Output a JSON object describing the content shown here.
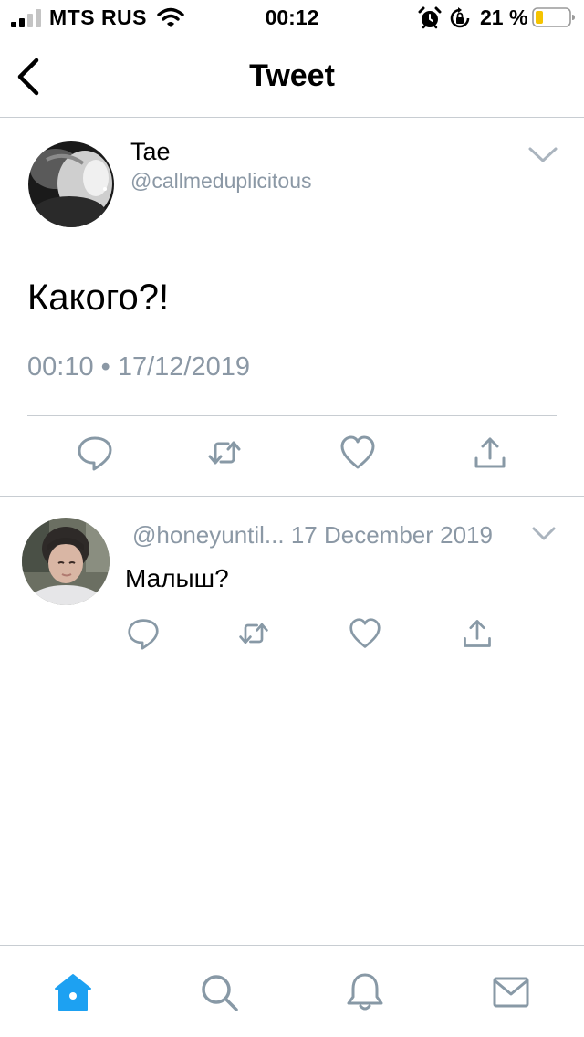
{
  "status_bar": {
    "carrier": "MTS RUS",
    "time": "00:12",
    "battery_percent": "21 %",
    "icons": [
      "signal-icon",
      "wifi-icon",
      "alarm-icon",
      "rotation-lock-icon",
      "battery-icon"
    ]
  },
  "nav": {
    "title": "Tweet",
    "back_icon": "chevron-left-icon"
  },
  "tweet": {
    "author_name": "Tae",
    "author_handle": "@callmeduplicitous",
    "text": "Какого?!",
    "timestamp": "00:10 • 17/12/2019",
    "actions": [
      "reply-icon",
      "retweet-icon",
      "like-icon",
      "share-icon"
    ]
  },
  "reply": {
    "header": "@honeyuntil... 17 December 2019",
    "text": "Малыш?",
    "actions": [
      "reply-icon",
      "retweet-icon",
      "like-icon",
      "share-icon"
    ]
  },
  "tab_bar": {
    "items": [
      "home-icon",
      "search-icon",
      "notifications-icon",
      "messages-icon"
    ],
    "active": "home-icon"
  },
  "colors": {
    "accent": "#1da1f2",
    "secondary_text": "#8b98a5",
    "icon_gray": "#8899a6",
    "divider": "#c8cdd2",
    "battery_low": "#f5c400"
  }
}
